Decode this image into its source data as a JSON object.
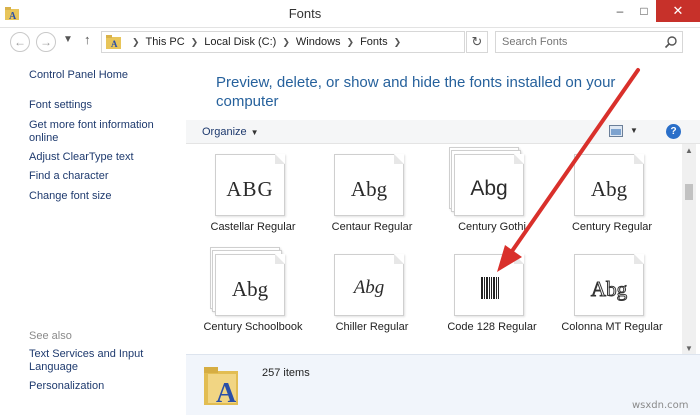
{
  "window": {
    "title": "Fonts",
    "minimize_label": "–",
    "maximize_label": "□",
    "close_label": "✕"
  },
  "address": {
    "crumbs": [
      "This PC",
      "Local Disk (C:)",
      "Windows",
      "Fonts"
    ],
    "search_placeholder": "Search Fonts"
  },
  "nav": {
    "home": "Control Panel Home",
    "links": [
      "Font settings",
      "Get more font information online",
      "Adjust ClearType text",
      "Find a character",
      "Change font size"
    ],
    "see_also_title": "See also",
    "see_also": [
      "Text Services and Input Language",
      "Personalization"
    ]
  },
  "main": {
    "headline": "Preview, delete, or show and hide the fonts installed on your computer",
    "organize_label": "Organize",
    "help_label": "?",
    "fonts": [
      {
        "name": "Castellar Regular",
        "sample": "ABG",
        "family": false
      },
      {
        "name": "Centaur Regular",
        "sample": "Abg",
        "family": false
      },
      {
        "name": "Century Gothi",
        "sample": "Abg",
        "family": true
      },
      {
        "name": "Century Regular",
        "sample": "Abg",
        "family": false
      },
      {
        "name": "Century Schoolbook",
        "sample": "Abg",
        "family": true
      },
      {
        "name": "Chiller Regular",
        "sample": "Abg",
        "family": false
      },
      {
        "name": "Code 128 Regular",
        "sample": "",
        "family": false
      },
      {
        "name": "Colonna MT Regular",
        "sample": "Abg",
        "family": false
      }
    ]
  },
  "details": {
    "count": "257 items"
  },
  "colors": {
    "accent": "#26619c",
    "link": "#1e3a6e",
    "close": "#c7312a",
    "arrow": "#d9302b"
  },
  "watermark": "wsxdn.com"
}
